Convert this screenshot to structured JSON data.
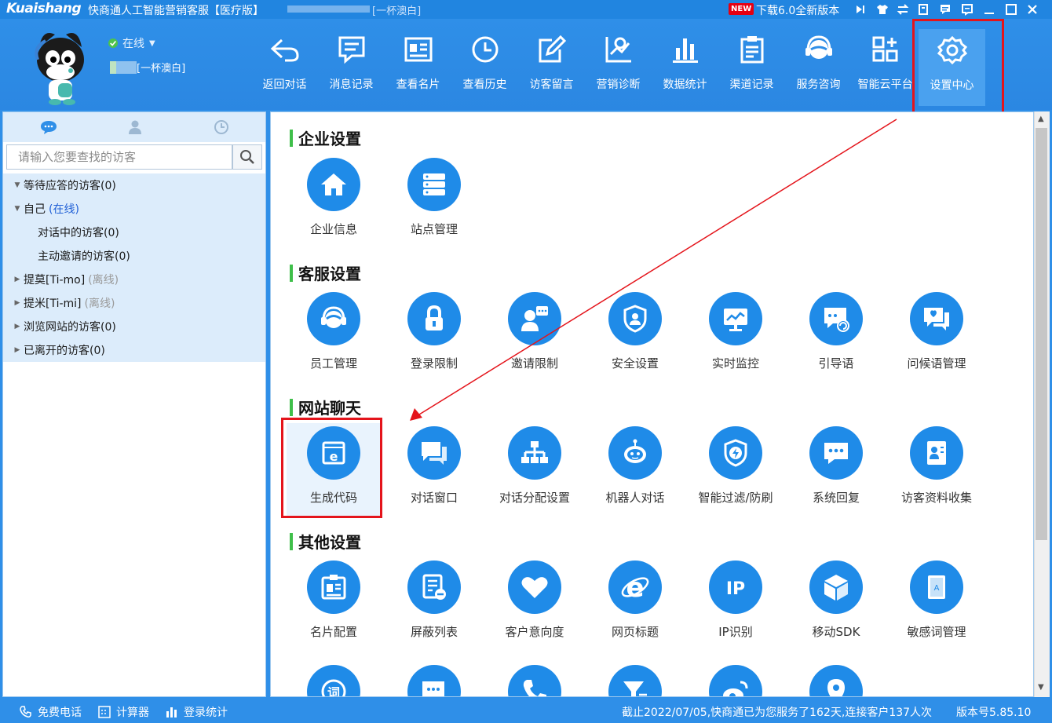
{
  "titlebar": {
    "logo": "Kuaishang",
    "app_title": "快商通人工智能营销客服【医疗版】",
    "account_suffix": "[一杯澳白]",
    "new_badge": "NEW",
    "download_text": "下载6.0全新版本"
  },
  "user": {
    "status": "在线",
    "nickname_suffix": "[一杯澳白]"
  },
  "toolbar": [
    {
      "label": "返回对话",
      "icon": "back-arrow-icon"
    },
    {
      "label": "消息记录",
      "icon": "message-record-icon"
    },
    {
      "label": "查看名片",
      "icon": "business-card-icon"
    },
    {
      "label": "查看历史",
      "icon": "history-clock-icon"
    },
    {
      "label": "访客留言",
      "icon": "edit-note-icon"
    },
    {
      "label": "营销诊断",
      "icon": "diagnosis-chart-icon"
    },
    {
      "label": "数据统计",
      "icon": "bar-stats-icon"
    },
    {
      "label": "渠道记录",
      "icon": "clipboard-icon"
    },
    {
      "label": "服务咨询",
      "icon": "headset-icon"
    },
    {
      "label": "智能云平台",
      "icon": "cloud-grid-icon"
    },
    {
      "label": "设置中心",
      "icon": "gear-icon",
      "active": true
    }
  ],
  "sidebar": {
    "search_placeholder": "请输入您要查找的访客",
    "tree": [
      {
        "label": "等待应答的访客(0)"
      },
      {
        "label": "自己",
        "status": "(在线)"
      },
      {
        "label": "对话中的访客(0)"
      },
      {
        "label": "主动邀请的访客(0)"
      },
      {
        "label": "提莫[Ti-mo]",
        "status": "(离线)"
      },
      {
        "label": "提米[Ti-mi]",
        "status": "(离线)"
      },
      {
        "label": "浏览网站的访客(0)"
      },
      {
        "label": "已离开的访客(0)"
      }
    ]
  },
  "sections": [
    {
      "title": "企业设置",
      "items": [
        {
          "label": "企业信息",
          "icon": "home-icon"
        },
        {
          "label": "站点管理",
          "icon": "server-icon"
        }
      ]
    },
    {
      "title": "客服设置",
      "items": [
        {
          "label": "员工管理",
          "icon": "agent-headset-icon"
        },
        {
          "label": "登录限制",
          "icon": "lock-icon"
        },
        {
          "label": "邀请限制",
          "icon": "invite-user-icon"
        },
        {
          "label": "安全设置",
          "icon": "shield-user-icon"
        },
        {
          "label": "实时监控",
          "icon": "monitor-icon"
        },
        {
          "label": "引导语",
          "icon": "guide-chat-icon"
        },
        {
          "label": "问候语管理",
          "icon": "greeting-chat-icon"
        }
      ]
    },
    {
      "title": "网站聊天",
      "items": [
        {
          "label": "生成代码",
          "icon": "browser-code-icon"
        },
        {
          "label": "对话窗口",
          "icon": "chat-window-icon"
        },
        {
          "label": "对话分配设置",
          "icon": "org-tree-icon"
        },
        {
          "label": "机器人对话",
          "icon": "robot-icon"
        },
        {
          "label": "智能过滤/防刷",
          "icon": "shield-bolt-icon"
        },
        {
          "label": "系统回复",
          "icon": "system-reply-icon"
        },
        {
          "label": "访客资料收集",
          "icon": "contact-card-icon"
        }
      ]
    },
    {
      "title": "其他设置",
      "items": [
        {
          "label": "名片配置",
          "icon": "id-card-icon"
        },
        {
          "label": "屏蔽列表",
          "icon": "block-list-icon"
        },
        {
          "label": "客户意向度",
          "icon": "heart-icon"
        },
        {
          "label": "网页标题",
          "icon": "ie-icon"
        },
        {
          "label": "IP识别",
          "icon": "ip-icon"
        },
        {
          "label": "移动SDK",
          "icon": "cube-icon"
        },
        {
          "label": "敏感词管理",
          "icon": "book-icon"
        }
      ]
    },
    {
      "title": "",
      "items": [
        {
          "label": "",
          "icon": "word-icon"
        },
        {
          "label": "",
          "icon": "chat-dots-icon"
        },
        {
          "label": "",
          "icon": "phone-icon"
        },
        {
          "label": "",
          "icon": "filter-icon"
        },
        {
          "label": "",
          "icon": "weibo-icon"
        },
        {
          "label": "",
          "icon": "location-icon"
        }
      ]
    }
  ],
  "statusbar": {
    "free_call": "免费电话",
    "calculator": "计算器",
    "login_stats": "登录统计",
    "service_text": "截止2022/07/05,快商通已为您服务了162天,连接客户137人次",
    "version": "版本号5.85.10"
  },
  "colors": {
    "accent": "#2f8fe8",
    "icon_blue": "#1f8be8",
    "highlight_red": "#e4141b",
    "section_bar": "#3fbf4a"
  }
}
